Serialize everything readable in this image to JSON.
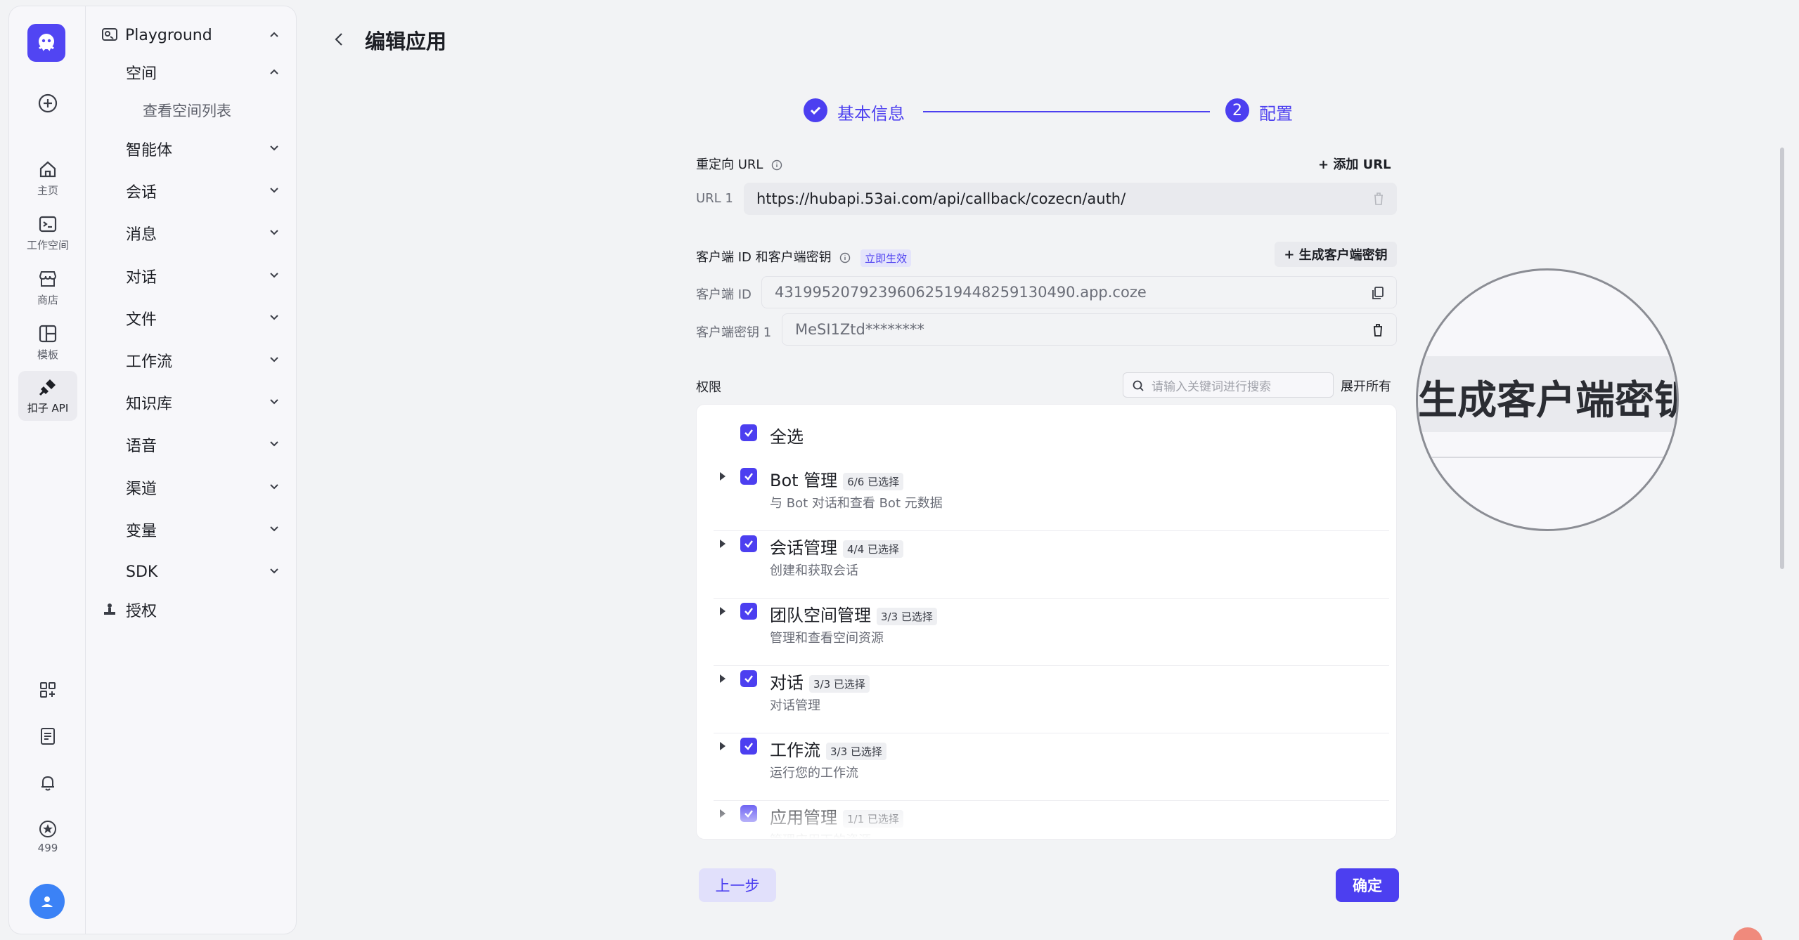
{
  "rail": {
    "items": [
      {
        "label": ""
      },
      {
        "label": "主页"
      },
      {
        "label": "工作空间"
      },
      {
        "label": "商店"
      },
      {
        "label": "模板"
      },
      {
        "label": "扣子 API"
      }
    ],
    "credits": "499"
  },
  "nav": {
    "root": "Playground",
    "space": "空间",
    "space_list": "查看空间列表",
    "items": [
      "智能体",
      "会话",
      "消息",
      "对话",
      "文件",
      "工作流",
      "知识库",
      "语音",
      "渠道",
      "变量",
      "SDK"
    ],
    "auth": "授权"
  },
  "page": {
    "title": "编辑应用",
    "steps": {
      "step1": "基本信息",
      "step2_num": "2",
      "step2": "配置"
    }
  },
  "redirect": {
    "label": "重定向 URL",
    "add_label": "添加 URL",
    "url_label": "URL 1",
    "url_value": "https://hubapi.53ai.com/api/callback/cozecn/auth/"
  },
  "client": {
    "label": "客户端 ID 和客户端密钥",
    "badge": "立即生效",
    "gen_label": "生成客户端密钥",
    "id_label": "客户端 ID",
    "id_value": "43199520792396062519448259130490.app.coze",
    "secret_label": "客户端密钥 1",
    "secret_value": "MeSI1Ztd********"
  },
  "perms": {
    "label": "权限",
    "search_placeholder": "请输入关键词进行搜索",
    "expand_label": "展开所有",
    "select_all": "全选",
    "rows": [
      {
        "name": "Bot 管理",
        "count": "6/6 已选择",
        "desc": "与 Bot 对话和查看 Bot 元数据"
      },
      {
        "name": "会话管理",
        "count": "4/4 已选择",
        "desc": "创建和获取会话"
      },
      {
        "name": "团队空间管理",
        "count": "3/3 已选择",
        "desc": "管理和查看空间资源"
      },
      {
        "name": "对话",
        "count": "3/3 已选择",
        "desc": "对话管理"
      },
      {
        "name": "工作流",
        "count": "3/3 已选择",
        "desc": "运行您的工作流"
      },
      {
        "name": "应用管理",
        "count": "1/1 已选择",
        "desc": "管理应用下的资源"
      }
    ]
  },
  "footer": {
    "prev": "上一步",
    "ok": "确定"
  },
  "magnifier": {
    "text": "生成客户端密钥"
  },
  "colors": {
    "accent": "#4c3ff0",
    "background": "#f2f3f5"
  }
}
